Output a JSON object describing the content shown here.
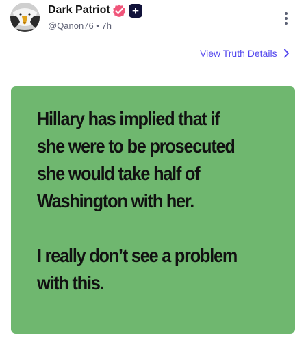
{
  "post": {
    "author": {
      "display_name": "Dark Patriot",
      "handle_time": "@Qanon76 • 7h",
      "avatar_icon": "eagle-avatar",
      "verified_icon": "verified-badge-icon",
      "verified_color": "#f0557a",
      "plus_label": "+"
    },
    "view_details_label": "View Truth Details",
    "image_text": {
      "lines_1": [
        "Hillary has implied that if",
        "she were to be prosecuted",
        "she would take half of",
        "Washington with her."
      ],
      "lines_2": [
        "I really don’t see a problem",
        "with this."
      ]
    },
    "colors": {
      "image_background": "#6fb76f",
      "link": "#5448ee"
    }
  }
}
